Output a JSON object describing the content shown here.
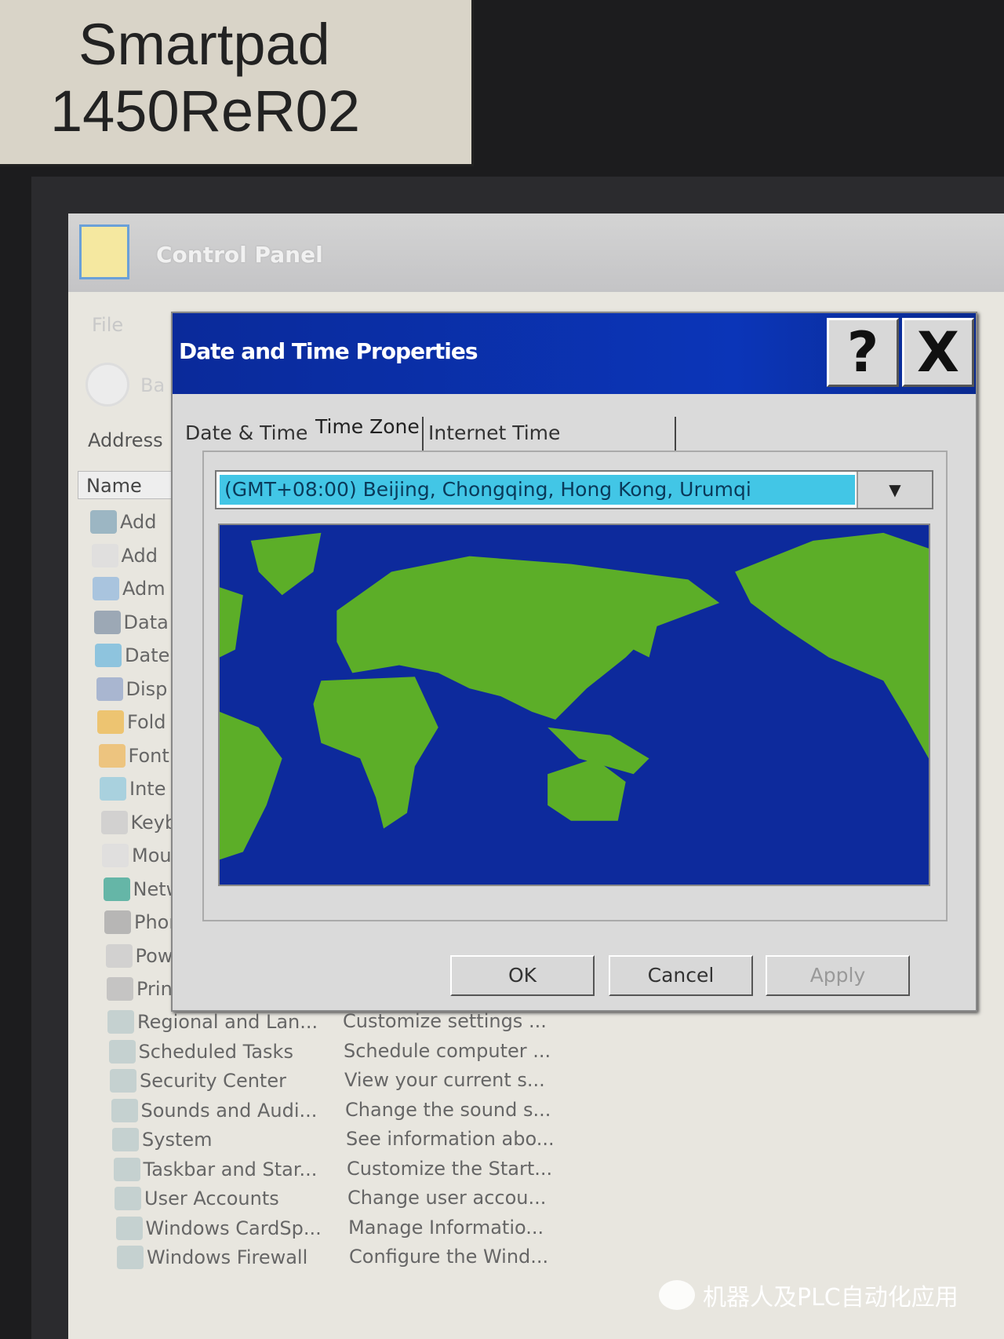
{
  "label": {
    "line1": "Smartpad",
    "line2": "1450ReR02"
  },
  "control_panel": {
    "title": "Control Panel",
    "menu": "File",
    "back_label": "Ba",
    "address_label": "Address",
    "column_name": "Name",
    "partial_items": [
      "Add",
      "Add",
      "Adm",
      "Data",
      "Date",
      "Disp",
      "Fold",
      "Font",
      "Inte",
      "Keyb",
      "Mou",
      "Netw",
      "Phor",
      "Pow",
      "Print"
    ],
    "items": [
      {
        "name": "Regional and Lan...",
        "desc": "Customize settings ..."
      },
      {
        "name": "Scheduled Tasks",
        "desc": "Schedule computer ..."
      },
      {
        "name": "Security Center",
        "desc": "View your current s..."
      },
      {
        "name": "Sounds and Audi...",
        "desc": "Change the sound s..."
      },
      {
        "name": "System",
        "desc": "See information abo..."
      },
      {
        "name": "Taskbar and Star...",
        "desc": "Customize the Start..."
      },
      {
        "name": "User Accounts",
        "desc": "Change user accou..."
      },
      {
        "name": "Windows CardSp...",
        "desc": "Manage Informatio..."
      },
      {
        "name": "Windows Firewall",
        "desc": "Configure the Wind..."
      }
    ]
  },
  "dialog": {
    "title": "Date and Time Properties",
    "help_label": "?",
    "close_label": "X",
    "tabs": [
      {
        "label": "Date & Time",
        "active": false
      },
      {
        "label": "Time Zone",
        "active": true
      },
      {
        "label": "Internet Time",
        "active": false
      }
    ],
    "timezone": "(GMT+08:00) Beijing, Chongqing, Hong Kong, Urumqi",
    "ok": "OK",
    "cancel": "Cancel",
    "apply": "Apply",
    "colors": {
      "title_bar": "#0b35b8",
      "map_ocean": "#0d2a9c",
      "map_land": "#5cae28",
      "selection": "#42c6e6"
    }
  },
  "watermark": "机器人及PLC自动化应用"
}
